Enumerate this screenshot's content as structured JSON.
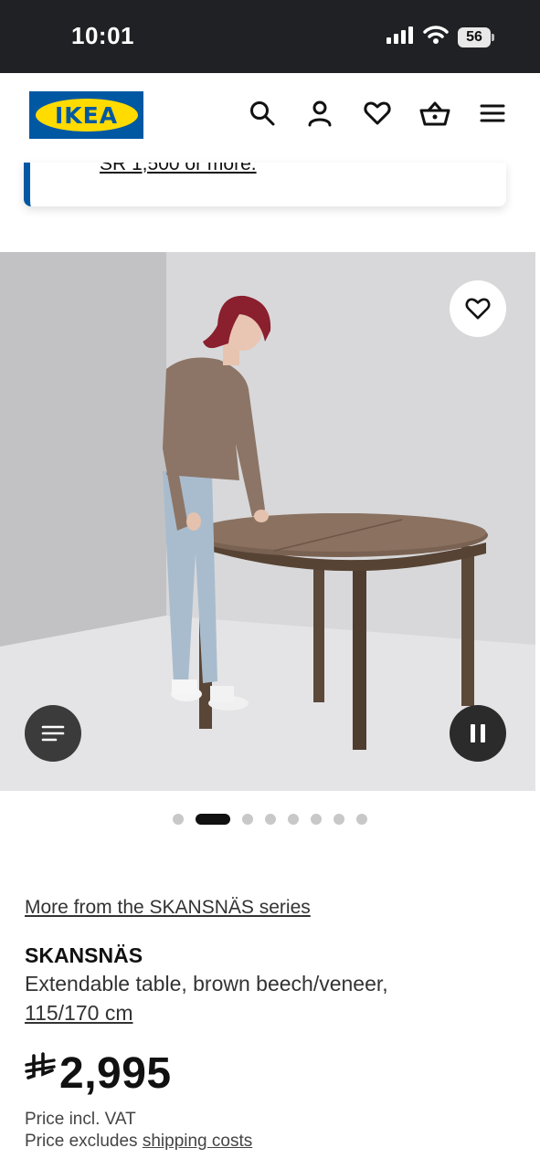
{
  "status_bar": {
    "time": "10:01",
    "battery": "56",
    "icons": [
      "signal-icon",
      "wifi-icon",
      "battery-icon"
    ]
  },
  "header": {
    "logo_text": "IKEA",
    "icons": [
      "search-icon",
      "account-icon",
      "heart-icon",
      "basket-icon",
      "menu-icon"
    ],
    "colors": {
      "brand_blue": "#0058a3",
      "brand_yellow": "#ffdb00"
    }
  },
  "notice": {
    "text": "SR 1,500 or more."
  },
  "gallery": {
    "slide_count": 8,
    "active_index": 1
  },
  "product": {
    "series_link": "More from the SKANSNÄS series",
    "name": "SKANSNÄS",
    "description": "Extendable table, brown beech/veneer,",
    "size": "115/170 cm",
    "currency_symbol": "⃁",
    "price": "2,995",
    "vat_note": "Price incl. VAT",
    "shipping_prefix": "Price excludes",
    "shipping_link": "shipping costs"
  }
}
